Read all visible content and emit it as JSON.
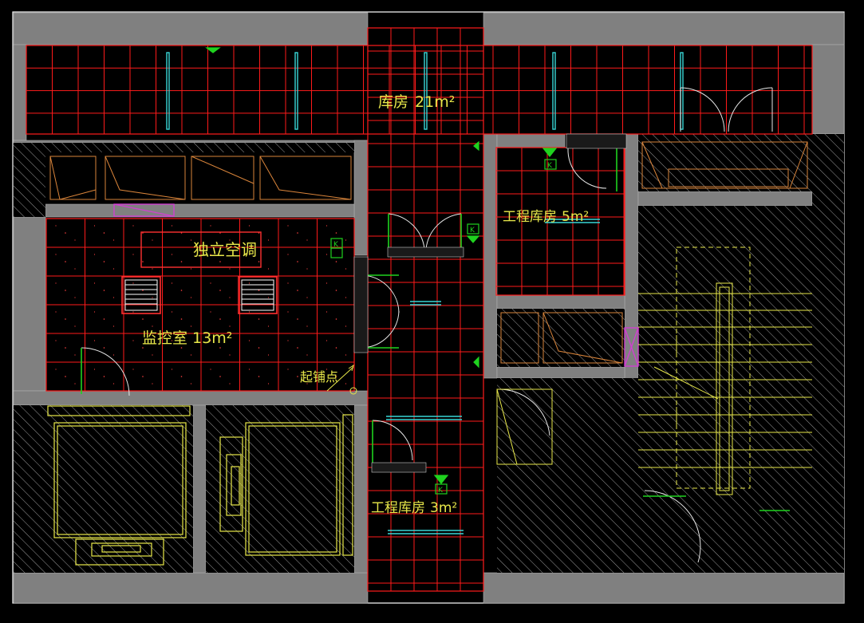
{
  "drawing": {
    "background": "#000000",
    "colors": {
      "wall": "#808080",
      "hatch": "#a8a8a8",
      "tile_grid": "#ff1a1a",
      "door": "#ffffff",
      "equipment_green": "#1fd21f",
      "fixture_yellow": "#e8e84a",
      "cabinet_orange": "#d9843a",
      "window_cyan": "#38d6d6",
      "magenta": "#d040d0",
      "frame_white": "#ffffff"
    },
    "rooms": {
      "storage_main": {
        "name": "库房",
        "area": "21m²"
      },
      "eng_storage_5": {
        "name": "工程库房",
        "area": "5m²"
      },
      "monitor_room": {
        "name": "监控室",
        "area": "13m²"
      },
      "eng_storage_3": {
        "name": "工程库房",
        "area": "3m²"
      }
    },
    "labels": {
      "ac_unit": "独立空调",
      "paving_start": "起铺点"
    },
    "equipment_symbols": [
      {
        "id": "k-monitor",
        "text": "K"
      },
      {
        "id": "k-corridor",
        "text": "K"
      },
      {
        "id": "k-eng5",
        "text": "K"
      },
      {
        "id": "k-eng3",
        "text": "K"
      }
    ]
  }
}
